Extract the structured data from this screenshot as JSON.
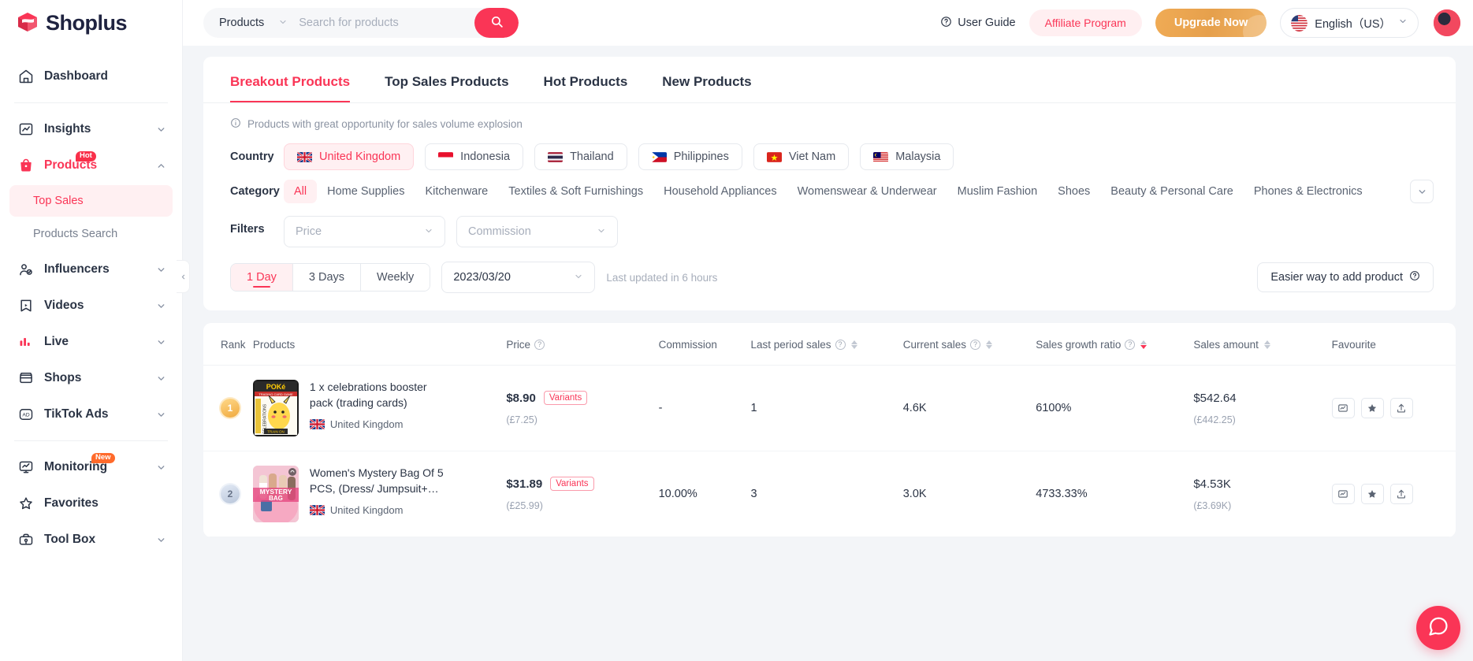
{
  "brand": {
    "name": "Shoplus"
  },
  "sidebar": {
    "items": [
      {
        "label": "Dashboard",
        "icon": "home-icon",
        "expandable": false,
        "badge": null,
        "active": false
      },
      {
        "label": "Insights",
        "icon": "chart-line-icon",
        "expandable": true,
        "badge": null,
        "active": false
      },
      {
        "label": "Products",
        "icon": "bag-icon",
        "expandable": true,
        "badge": "Hot",
        "active": true
      },
      {
        "label": "Influencers",
        "icon": "user-check-icon",
        "expandable": true,
        "badge": null,
        "active": false
      },
      {
        "label": "Videos",
        "icon": "video-bookmark-icon",
        "expandable": true,
        "badge": null,
        "active": false
      },
      {
        "label": "Live",
        "icon": "bars-icon",
        "expandable": true,
        "badge": null,
        "active": false
      },
      {
        "label": "Shops",
        "icon": "store-icon",
        "expandable": true,
        "badge": null,
        "active": false
      },
      {
        "label": "TikTok Ads",
        "icon": "ad-icon",
        "expandable": true,
        "badge": null,
        "active": false
      },
      {
        "label": "Monitoring",
        "icon": "monitor-icon",
        "expandable": true,
        "badge": "New",
        "active": false
      },
      {
        "label": "Favorites",
        "icon": "star-icon",
        "expandable": false,
        "badge": null,
        "active": false
      },
      {
        "label": "Tool Box",
        "icon": "toolbox-icon",
        "expandable": true,
        "badge": null,
        "active": false
      }
    ],
    "sub_items": [
      {
        "label": "Top Sales",
        "active": true
      },
      {
        "label": "Products Search",
        "active": false
      }
    ]
  },
  "topbar": {
    "search_category": "Products",
    "search_placeholder": "Search for products",
    "search_value": "",
    "user_guide": "User Guide",
    "affiliate": "Affiliate Program",
    "upgrade": "Upgrade Now",
    "language": "English（US）"
  },
  "tabs": [
    {
      "label": "Breakout Products",
      "active": true
    },
    {
      "label": "Top Sales Products",
      "active": false
    },
    {
      "label": "Hot Products",
      "active": false
    },
    {
      "label": "New Products",
      "active": false
    }
  ],
  "hint": "Products with great opportunity for sales volume explosion",
  "filters": {
    "country_label": "Country",
    "countries": [
      {
        "label": "United Kingdom",
        "flag": "uk",
        "active": true
      },
      {
        "label": "Indonesia",
        "flag": "id",
        "active": false
      },
      {
        "label": "Thailand",
        "flag": "th",
        "active": false
      },
      {
        "label": "Philippines",
        "flag": "ph",
        "active": false
      },
      {
        "label": "Viet Nam",
        "flag": "vn",
        "active": false
      },
      {
        "label": "Malaysia",
        "flag": "my",
        "active": false
      }
    ],
    "category_label": "Category",
    "categories": [
      {
        "label": "All",
        "active": true
      },
      {
        "label": "Home Supplies",
        "active": false
      },
      {
        "label": "Kitchenware",
        "active": false
      },
      {
        "label": "Textiles & Soft Furnishings",
        "active": false
      },
      {
        "label": "Household Appliances",
        "active": false
      },
      {
        "label": "Womenswear & Underwear",
        "active": false
      },
      {
        "label": "Muslim Fashion",
        "active": false
      },
      {
        "label": "Shoes",
        "active": false
      },
      {
        "label": "Beauty & Personal Care",
        "active": false
      },
      {
        "label": "Phones & Electronics",
        "active": false
      }
    ],
    "filters_label": "Filters",
    "price_placeholder": "Price",
    "commission_placeholder": "Commission"
  },
  "timebar": {
    "segments": [
      {
        "label": "1 Day",
        "active": true
      },
      {
        "label": "3 Days",
        "active": false
      },
      {
        "label": "Weekly",
        "active": false
      }
    ],
    "date": "2023/03/20",
    "updated": "Last updated in 6 hours",
    "easier": "Easier way to add product"
  },
  "table": {
    "columns": [
      {
        "key": "rank",
        "label": "Rank",
        "help": false,
        "sort": "none"
      },
      {
        "key": "products",
        "label": "Products",
        "help": false,
        "sort": "none"
      },
      {
        "key": "price",
        "label": "Price",
        "help": true,
        "sort": "none"
      },
      {
        "key": "commission",
        "label": "Commission",
        "help": false,
        "sort": "none"
      },
      {
        "key": "last_period_sales",
        "label": "Last period sales",
        "help": true,
        "sort": "both"
      },
      {
        "key": "current_sales",
        "label": "Current sales",
        "help": true,
        "sort": "both"
      },
      {
        "key": "sales_growth_ratio",
        "label": "Sales growth ratio",
        "help": true,
        "sort": "desc"
      },
      {
        "key": "sales_amount",
        "label": "Sales amount",
        "help": false,
        "sort": "both"
      },
      {
        "key": "favourite",
        "label": "Favourite",
        "help": false,
        "sort": "none"
      }
    ],
    "rows": [
      {
        "rank": "1",
        "title": "1 x celebrations booster pack (trading cards)",
        "country": "United Kingdom",
        "thumb": "pokemon",
        "price": "$8.90",
        "price_alt": "(£7.25)",
        "variants": "Variants",
        "commission": "-",
        "last_period_sales": "1",
        "current_sales": "4.6K",
        "sales_growth_ratio": "6100%",
        "sales_amount": "$542.64",
        "sales_amount_alt": "(£442.25)"
      },
      {
        "rank": "2",
        "title": "Women's Mystery Bag Of 5 PCS, (Dress/ Jumpsuit+…",
        "country": "United Kingdom",
        "thumb": "mystery",
        "price": "$31.89",
        "price_alt": "(£25.99)",
        "variants": "Variants",
        "commission": "10.00%",
        "last_period_sales": "3",
        "current_sales": "3.0K",
        "sales_growth_ratio": "4733.33%",
        "sales_amount": "$4.53K",
        "sales_amount_alt": "(£3.69K)"
      }
    ],
    "row_actions": [
      {
        "name": "analytics-icon",
        "glyph": "▣"
      },
      {
        "name": "favourite-star-icon",
        "glyph": "★"
      },
      {
        "name": "export-icon",
        "glyph": "⇧"
      }
    ]
  },
  "colors": {
    "accent": "#fa3556",
    "accent_soft": "#fff0f2",
    "upgrade": "#e8a44f",
    "text": "#2b3445",
    "muted": "#8b93a2",
    "page_bg": "#f3f5f8"
  }
}
